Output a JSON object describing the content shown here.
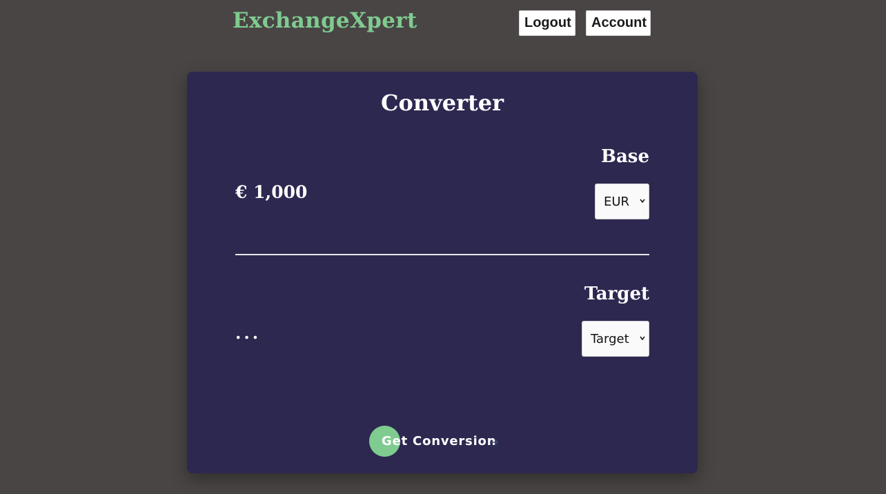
{
  "header": {
    "brand": "ExchangeXpert",
    "logout_label": "Logout",
    "account_label": "Account"
  },
  "converter": {
    "title": "Converter",
    "base": {
      "label": "Base",
      "amount": "€ 1,000",
      "selected_currency": "EUR"
    },
    "target": {
      "label": "Target",
      "result": "...",
      "selected_currency": "Target"
    },
    "submit_label": "Get Conversion",
    "icons": {
      "select_chevron": "chevron-down-icon",
      "submit_arrow": "arrow-right-icon"
    }
  },
  "colors": {
    "page_bg": "#4a4545",
    "card_bg": "#2d2850",
    "brand_accent": "#7fcb90",
    "text": "#ffffff"
  }
}
